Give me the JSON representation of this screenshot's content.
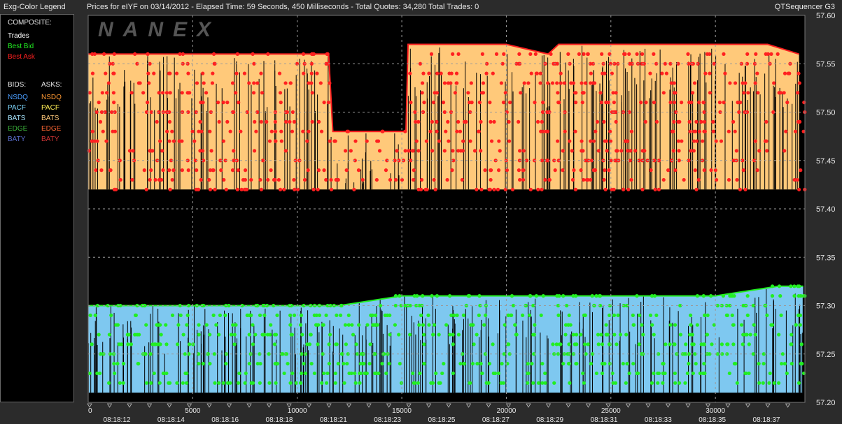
{
  "window": {
    "legend_title": "Exg-Color Legend",
    "title": "Prices for  eIYF  on  03/14/2012  -  Elapsed Time: 59 Seconds, 450 Milliseconds  -  Total Quotes: 34,280  Total Trades: 0",
    "app_name": "QTSequencer G3"
  },
  "watermark": "NANEX",
  "legend": {
    "composite_label": "COMPOSITE:",
    "trades": {
      "label": "Trades",
      "color": "#ffffff"
    },
    "best_bid": {
      "label": "Best Bid",
      "color": "#22ee22"
    },
    "best_ask": {
      "label": "Best Ask",
      "color": "#ff2020"
    },
    "bids_label": "BIDS:",
    "asks_label": "ASKS:",
    "bids": [
      {
        "label": "NSDQ",
        "color": "#4a9eff"
      },
      {
        "label": "PACF",
        "color": "#7fd8ff"
      },
      {
        "label": "BATS",
        "color": "#a8e6ff"
      },
      {
        "label": "EDGE",
        "color": "#3bb33b"
      },
      {
        "label": "BATY",
        "color": "#5a6dcc"
      }
    ],
    "asks": [
      {
        "label": "NSDQ",
        "color": "#ff9933"
      },
      {
        "label": "PACF",
        "color": "#ffee55"
      },
      {
        "label": "BATS",
        "color": "#ffc97a"
      },
      {
        "label": "EDGE",
        "color": "#ff6633"
      },
      {
        "label": "BATY",
        "color": "#cc3333"
      }
    ]
  },
  "chart_data": {
    "type": "scatter",
    "title": "Prices for  eIYF  on  03/14/2012",
    "ylim": [
      57.2,
      57.6
    ],
    "y_ticks": [
      57.6,
      57.55,
      57.5,
      57.45,
      57.4,
      57.35,
      57.3,
      57.25,
      57.2
    ],
    "y_tick_labels": [
      "57.60",
      "57.55",
      "57.50",
      "57.45",
      "57.40",
      "57.35",
      "57.30",
      "57.25",
      "57.20"
    ],
    "xlim": [
      0,
      34280
    ],
    "x_ticks": [
      0,
      5000,
      10000,
      15000,
      20000,
      25000,
      30000
    ],
    "x_tick_labels": [
      "0",
      "5000",
      "10000",
      "15000",
      "20000",
      "25000",
      "30000"
    ],
    "time_labels": [
      "08:18:12",
      "08:18:14",
      "08:18:16",
      "08:18:18",
      "08:18:21",
      "08:18:23",
      "08:18:25",
      "08:18:27",
      "08:18:29",
      "08:18:31",
      "08:18:33",
      "08:18:35",
      "08:18:37"
    ],
    "grid": true,
    "series": [
      {
        "name": "Best Ask",
        "color": "#ff2020",
        "points": [
          [
            0,
            57.56
          ],
          [
            1000,
            57.56
          ],
          [
            2500,
            57.56
          ],
          [
            5000,
            57.56
          ],
          [
            7500,
            57.56
          ],
          [
            10000,
            57.56
          ],
          [
            11500,
            57.56
          ],
          [
            11700,
            57.48
          ],
          [
            14000,
            57.48
          ],
          [
            15200,
            57.48
          ],
          [
            15300,
            57.57
          ],
          [
            17500,
            57.57
          ],
          [
            20000,
            57.57
          ],
          [
            22000,
            57.56
          ],
          [
            22500,
            57.57
          ],
          [
            25000,
            57.57
          ],
          [
            27500,
            57.57
          ],
          [
            30000,
            57.57
          ],
          [
            32500,
            57.57
          ],
          [
            34000,
            57.56
          ]
        ]
      },
      {
        "name": "Best Bid",
        "color": "#22ee22",
        "points": [
          [
            0,
            57.3
          ],
          [
            2500,
            57.3
          ],
          [
            5000,
            57.3
          ],
          [
            7500,
            57.3
          ],
          [
            10000,
            57.3
          ],
          [
            12000,
            57.3
          ],
          [
            15000,
            57.31
          ],
          [
            17500,
            57.31
          ],
          [
            20000,
            57.31
          ],
          [
            22500,
            57.31
          ],
          [
            25000,
            57.31
          ],
          [
            27500,
            57.31
          ],
          [
            30000,
            57.31
          ],
          [
            33000,
            57.32
          ],
          [
            34200,
            57.32
          ]
        ]
      }
    ],
    "ask_price_levels": [
      57.56,
      57.55,
      57.54,
      57.53,
      57.52,
      57.51,
      57.5,
      57.49,
      57.48,
      57.47,
      57.46,
      57.45,
      57.44,
      57.43,
      57.42
    ],
    "bid_price_levels": [
      57.32,
      57.31,
      57.3,
      57.29,
      57.28,
      57.27,
      57.26,
      57.25,
      57.24,
      57.23,
      57.22
    ],
    "ask_band": {
      "low": 57.42,
      "color": "#ffc97a"
    },
    "bid_band": {
      "low": 57.21,
      "color": "#7ec8f0"
    }
  }
}
